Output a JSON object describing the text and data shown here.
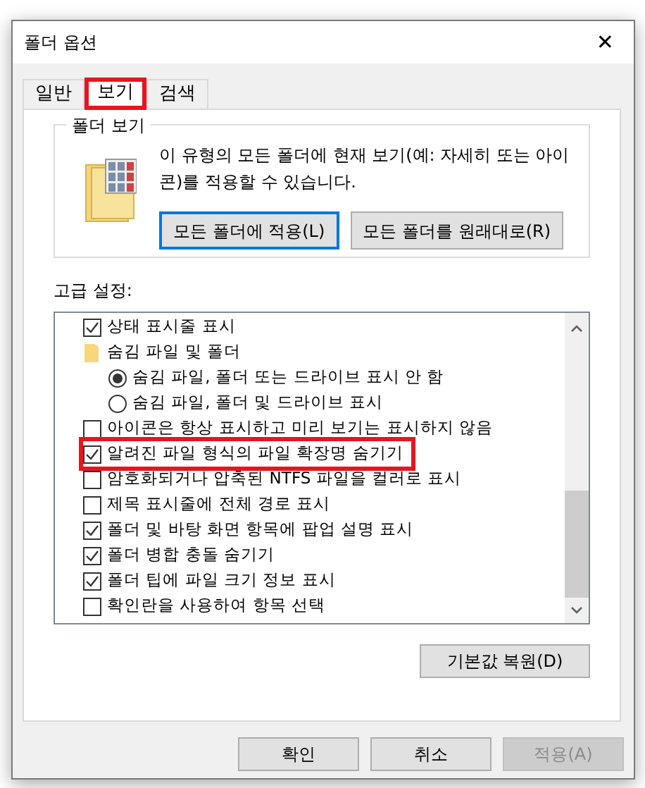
{
  "window": {
    "title": "폴더 옵션",
    "close": "✕"
  },
  "tabs": [
    {
      "label": "일반",
      "selected": false,
      "highlighted": false
    },
    {
      "label": "보기",
      "selected": true,
      "highlighted": true
    },
    {
      "label": "검색",
      "selected": false,
      "highlighted": false
    }
  ],
  "folder_views": {
    "title": "폴더 보기",
    "description": "이 유형의 모든 폴더에 현재 보기(예: 자세히 또는 아이콘)를 적용할 수 있습니다.",
    "buttons": [
      {
        "label": "모든 폴더에 적용(L)",
        "focused": true
      },
      {
        "label": "모든 폴더를 원래대로(R)",
        "focused": false
      }
    ]
  },
  "advanced": {
    "label": "고급 설정:",
    "items": [
      {
        "kind": "checkbox",
        "label": "상태 표시줄 표시",
        "checked": true,
        "highlighted": false
      },
      {
        "kind": "folder",
        "label": "숨김 파일 및 폴더",
        "highlighted": false,
        "children": [
          {
            "kind": "radio",
            "label": "숨김 파일, 폴더 또는 드라이브 표시 안 함",
            "checked": true,
            "highlighted": false
          },
          {
            "kind": "radio",
            "label": "숨김 파일, 폴더 및 드라이브 표시",
            "checked": false,
            "highlighted": false
          }
        ]
      },
      {
        "kind": "checkbox",
        "label": "아이콘은 항상 표시하고 미리 보기는 표시하지 않음",
        "checked": false,
        "highlighted": false
      },
      {
        "kind": "checkbox",
        "label": "알려진 파일 형식의 파일 확장명 숨기기",
        "checked": true,
        "highlighted": true
      },
      {
        "kind": "checkbox",
        "label": "암호화되거나 압축된 NTFS 파일을 컬러로 표시",
        "checked": false,
        "highlighted": false
      },
      {
        "kind": "checkbox",
        "label": "제목 표시줄에 전체 경로 표시",
        "checked": false,
        "highlighted": false
      },
      {
        "kind": "checkbox",
        "label": "폴더 및 바탕 화면 항목에 팝업 설명 표시",
        "checked": true,
        "highlighted": false
      },
      {
        "kind": "checkbox",
        "label": "폴더 병합 충돌 숨기기",
        "checked": true,
        "highlighted": false
      },
      {
        "kind": "checkbox",
        "label": "폴더 팁에 파일 크기 정보 표시",
        "checked": true,
        "highlighted": false
      },
      {
        "kind": "checkbox",
        "label": "확인란을 사용하여 항목 선택",
        "checked": false,
        "highlighted": false
      }
    ],
    "restore_button": "기본값 복원(D)"
  },
  "buttons": [
    {
      "label": "확인",
      "disabled": false
    },
    {
      "label": "취소",
      "disabled": false
    },
    {
      "label": "적용(A)",
      "disabled": true
    }
  ]
}
